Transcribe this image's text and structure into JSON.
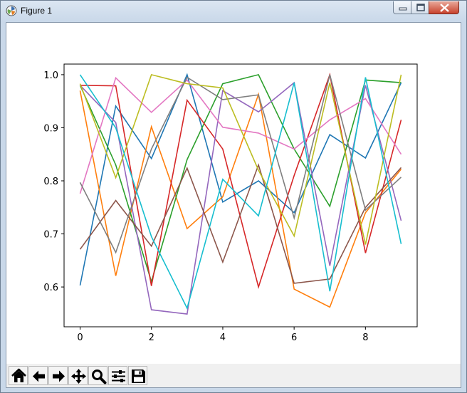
{
  "window": {
    "title": "Figure 1",
    "controls": [
      "minimize",
      "maximize",
      "close"
    ]
  },
  "toolbar": {
    "tools": [
      {
        "name": "home-icon",
        "label": "Home"
      },
      {
        "name": "back-arrow-icon",
        "label": "Back"
      },
      {
        "name": "forward-arrow-icon",
        "label": "Forward"
      },
      {
        "name": "pan-move-icon",
        "label": "Pan"
      },
      {
        "name": "zoom-magnifier-icon",
        "label": "Zoom"
      },
      {
        "name": "configure-subplots-icon",
        "label": "Subplots"
      },
      {
        "name": "save-floppy-icon",
        "label": "Save"
      }
    ]
  },
  "chart_data": {
    "type": "line",
    "title": "",
    "xlabel": "",
    "ylabel": "",
    "x": [
      0,
      1,
      2,
      3,
      4,
      5,
      6,
      7,
      8,
      9
    ],
    "xlim": [
      -0.45,
      9.45
    ],
    "ylim": [
      0.525,
      1.02
    ],
    "xticks": [
      0,
      2,
      4,
      6,
      8
    ],
    "yticks": [
      0.6,
      0.7,
      0.8,
      0.9,
      1.0
    ],
    "ytick_labels": [
      "0.6",
      "0.7",
      "0.8",
      "0.9",
      "1.0"
    ],
    "grid": false,
    "legend": "none",
    "series": [
      {
        "color": "#1f77b4",
        "values": [
          0.603,
          0.941,
          0.842,
          1.0,
          0.76,
          0.8,
          0.74,
          0.887,
          0.843,
          0.985
        ]
      },
      {
        "color": "#ff7f0e",
        "values": [
          0.97,
          0.621,
          0.902,
          0.71,
          0.77,
          0.963,
          0.596,
          0.562,
          0.74,
          0.822
        ]
      },
      {
        "color": "#2ca02c",
        "values": [
          0.98,
          0.83,
          0.61,
          0.84,
          0.983,
          1.0,
          0.86,
          0.752,
          0.99,
          0.985
        ]
      },
      {
        "color": "#d62728",
        "values": [
          0.98,
          0.979,
          0.602,
          0.952,
          0.86,
          0.6,
          0.81,
          1.0,
          0.664,
          0.915
        ]
      },
      {
        "color": "#9467bd",
        "values": [
          0.98,
          0.91,
          0.557,
          0.549,
          0.97,
          0.93,
          0.985,
          0.64,
          0.98,
          0.725
        ]
      },
      {
        "color": "#8c564b",
        "values": [
          0.671,
          0.763,
          0.677,
          0.824,
          0.647,
          0.83,
          0.607,
          0.615,
          0.75,
          0.825
        ]
      },
      {
        "color": "#e377c2",
        "values": [
          0.776,
          0.994,
          0.929,
          0.99,
          0.901,
          0.89,
          0.86,
          0.915,
          0.955,
          0.85
        ]
      },
      {
        "color": "#7f7f7f",
        "values": [
          0.797,
          0.665,
          0.86,
          0.995,
          0.953,
          0.962,
          0.73,
          1.0,
          0.745,
          0.807
        ]
      },
      {
        "color": "#bcbd22",
        "values": [
          0.983,
          0.806,
          1.0,
          0.983,
          0.975,
          0.82,
          0.696,
          0.985,
          0.68,
          1.0
        ]
      },
      {
        "color": "#17becf",
        "values": [
          1.0,
          0.9,
          0.695,
          0.56,
          0.803,
          0.734,
          0.985,
          0.592,
          0.995,
          0.681
        ]
      }
    ]
  }
}
